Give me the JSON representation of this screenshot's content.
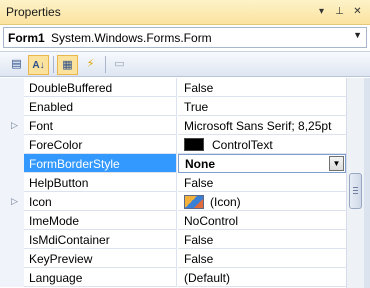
{
  "window": {
    "title": "Properties",
    "pin_glyph": "▾",
    "pushpin_glyph": "⊥",
    "close_glyph": "✕"
  },
  "object_selector": {
    "name": "Form1",
    "type": "System.Windows.Forms.Form",
    "dropdown_glyph": "▼"
  },
  "toolbar": {
    "categorized_glyph": "▤",
    "alphabetical_glyph": "A↓",
    "properties_glyph": "▦",
    "events_glyph": "⚡",
    "property_pages_glyph": "▭"
  },
  "properties": [
    {
      "name": "DoubleBuffered",
      "value": "False"
    },
    {
      "name": "Enabled",
      "value": "True"
    },
    {
      "name": "Font",
      "value": "Microsoft Sans Serif; 8,25pt",
      "expandable": true
    },
    {
      "name": "ForeColor",
      "value": "ControlText",
      "swatch": "#000000"
    },
    {
      "name": "FormBorderStyle",
      "value": "None",
      "selected": true
    },
    {
      "name": "HelpButton",
      "value": "False"
    },
    {
      "name": "Icon",
      "value": "(Icon)",
      "expandable": true
    },
    {
      "name": "ImeMode",
      "value": "NoControl"
    },
    {
      "name": "IsMdiContainer",
      "value": "False"
    },
    {
      "name": "KeyPreview",
      "value": "False"
    },
    {
      "name": "Language",
      "value": "(Default)"
    }
  ],
  "expander_glyph": "▷",
  "dropdown_glyph": "▼",
  "colors": {
    "selection": "#3399ff",
    "titlebar": "#fbe3a0"
  }
}
